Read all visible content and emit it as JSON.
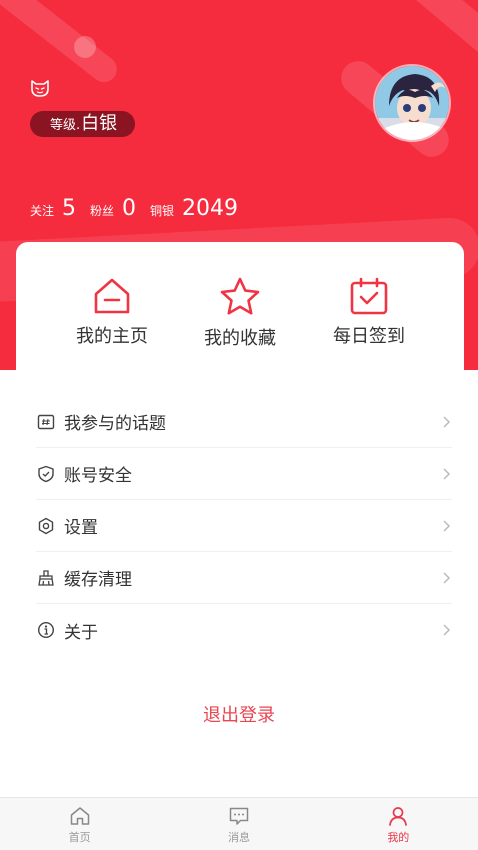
{
  "colors": {
    "brand": "#f52b3e",
    "badge": "#8a1422",
    "logout": "#e84652",
    "active_tab": "#e8384b"
  },
  "profile": {
    "level_prefix": "等级.",
    "level_value": "白银",
    "icon": "mask-icon",
    "avatar": "anime-avatar"
  },
  "stats": [
    {
      "label": "关注",
      "value": "5"
    },
    {
      "label": "粉丝",
      "value": "0"
    },
    {
      "label": "铜银",
      "value": "2049"
    }
  ],
  "quick_actions": [
    {
      "label": "我的主页",
      "icon": "home-icon"
    },
    {
      "label": "我的收藏",
      "icon": "star-icon"
    },
    {
      "label": "每日签到",
      "icon": "calendar-check-icon"
    }
  ],
  "menu": [
    {
      "label": "我参与的话题",
      "icon": "topic-icon"
    },
    {
      "label": "账号安全",
      "icon": "shield-icon"
    },
    {
      "label": "设置",
      "icon": "settings-icon"
    },
    {
      "label": "缓存清理",
      "icon": "broom-icon"
    },
    {
      "label": "关于",
      "icon": "info-icon"
    }
  ],
  "logout_label": "退出登录",
  "tabs": [
    {
      "label": "首页",
      "icon": "home-tab-icon"
    },
    {
      "label": "消息",
      "icon": "message-icon"
    },
    {
      "label": "我的",
      "icon": "user-icon",
      "active": true
    }
  ]
}
